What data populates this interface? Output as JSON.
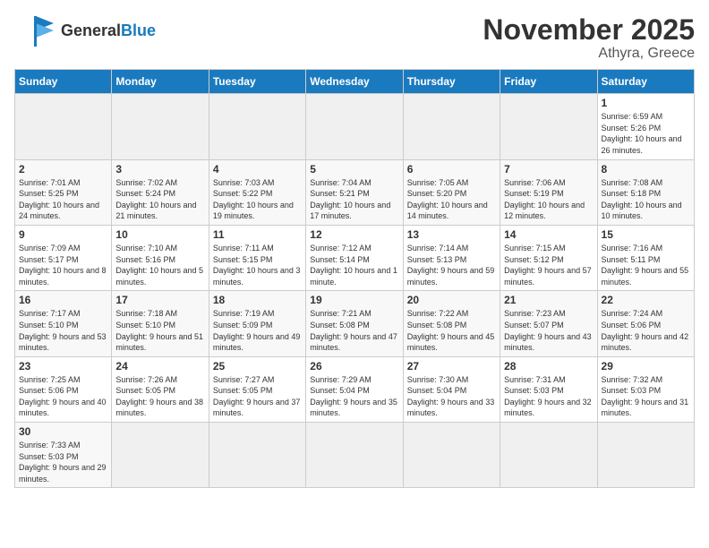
{
  "header": {
    "logo_general": "General",
    "logo_blue": "Blue",
    "title": "November 2025",
    "subtitle": "Athyra, Greece"
  },
  "days_of_week": [
    "Sunday",
    "Monday",
    "Tuesday",
    "Wednesday",
    "Thursday",
    "Friday",
    "Saturday"
  ],
  "weeks": [
    [
      {
        "day": "",
        "empty": true
      },
      {
        "day": "",
        "empty": true
      },
      {
        "day": "",
        "empty": true
      },
      {
        "day": "",
        "empty": true
      },
      {
        "day": "",
        "empty": true
      },
      {
        "day": "",
        "empty": true
      },
      {
        "day": "1",
        "sunrise": "6:59 AM",
        "sunset": "5:26 PM",
        "daylight": "10 hours and 26 minutes."
      }
    ],
    [
      {
        "day": "2",
        "sunrise": "7:01 AM",
        "sunset": "5:25 PM",
        "daylight": "10 hours and 24 minutes."
      },
      {
        "day": "3",
        "sunrise": "7:02 AM",
        "sunset": "5:24 PM",
        "daylight": "10 hours and 21 minutes."
      },
      {
        "day": "4",
        "sunrise": "7:03 AM",
        "sunset": "5:22 PM",
        "daylight": "10 hours and 19 minutes."
      },
      {
        "day": "5",
        "sunrise": "7:04 AM",
        "sunset": "5:21 PM",
        "daylight": "10 hours and 17 minutes."
      },
      {
        "day": "6",
        "sunrise": "7:05 AM",
        "sunset": "5:20 PM",
        "daylight": "10 hours and 14 minutes."
      },
      {
        "day": "7",
        "sunrise": "7:06 AM",
        "sunset": "5:19 PM",
        "daylight": "10 hours and 12 minutes."
      },
      {
        "day": "8",
        "sunrise": "7:08 AM",
        "sunset": "5:18 PM",
        "daylight": "10 hours and 10 minutes."
      }
    ],
    [
      {
        "day": "9",
        "sunrise": "7:09 AM",
        "sunset": "5:17 PM",
        "daylight": "10 hours and 8 minutes."
      },
      {
        "day": "10",
        "sunrise": "7:10 AM",
        "sunset": "5:16 PM",
        "daylight": "10 hours and 5 minutes."
      },
      {
        "day": "11",
        "sunrise": "7:11 AM",
        "sunset": "5:15 PM",
        "daylight": "10 hours and 3 minutes."
      },
      {
        "day": "12",
        "sunrise": "7:12 AM",
        "sunset": "5:14 PM",
        "daylight": "10 hours and 1 minute."
      },
      {
        "day": "13",
        "sunrise": "7:14 AM",
        "sunset": "5:13 PM",
        "daylight": "9 hours and 59 minutes."
      },
      {
        "day": "14",
        "sunrise": "7:15 AM",
        "sunset": "5:12 PM",
        "daylight": "9 hours and 57 minutes."
      },
      {
        "day": "15",
        "sunrise": "7:16 AM",
        "sunset": "5:11 PM",
        "daylight": "9 hours and 55 minutes."
      }
    ],
    [
      {
        "day": "16",
        "sunrise": "7:17 AM",
        "sunset": "5:10 PM",
        "daylight": "9 hours and 53 minutes."
      },
      {
        "day": "17",
        "sunrise": "7:18 AM",
        "sunset": "5:10 PM",
        "daylight": "9 hours and 51 minutes."
      },
      {
        "day": "18",
        "sunrise": "7:19 AM",
        "sunset": "5:09 PM",
        "daylight": "9 hours and 49 minutes."
      },
      {
        "day": "19",
        "sunrise": "7:21 AM",
        "sunset": "5:08 PM",
        "daylight": "9 hours and 47 minutes."
      },
      {
        "day": "20",
        "sunrise": "7:22 AM",
        "sunset": "5:08 PM",
        "daylight": "9 hours and 45 minutes."
      },
      {
        "day": "21",
        "sunrise": "7:23 AM",
        "sunset": "5:07 PM",
        "daylight": "9 hours and 43 minutes."
      },
      {
        "day": "22",
        "sunrise": "7:24 AM",
        "sunset": "5:06 PM",
        "daylight": "9 hours and 42 minutes."
      }
    ],
    [
      {
        "day": "23",
        "sunrise": "7:25 AM",
        "sunset": "5:06 PM",
        "daylight": "9 hours and 40 minutes."
      },
      {
        "day": "24",
        "sunrise": "7:26 AM",
        "sunset": "5:05 PM",
        "daylight": "9 hours and 38 minutes."
      },
      {
        "day": "25",
        "sunrise": "7:27 AM",
        "sunset": "5:05 PM",
        "daylight": "9 hours and 37 minutes."
      },
      {
        "day": "26",
        "sunrise": "7:29 AM",
        "sunset": "5:04 PM",
        "daylight": "9 hours and 35 minutes."
      },
      {
        "day": "27",
        "sunrise": "7:30 AM",
        "sunset": "5:04 PM",
        "daylight": "9 hours and 33 minutes."
      },
      {
        "day": "28",
        "sunrise": "7:31 AM",
        "sunset": "5:03 PM",
        "daylight": "9 hours and 32 minutes."
      },
      {
        "day": "29",
        "sunrise": "7:32 AM",
        "sunset": "5:03 PM",
        "daylight": "9 hours and 31 minutes."
      }
    ],
    [
      {
        "day": "30",
        "sunrise": "7:33 AM",
        "sunset": "5:03 PM",
        "daylight": "9 hours and 29 minutes."
      },
      {
        "day": "",
        "empty": true
      },
      {
        "day": "",
        "empty": true
      },
      {
        "day": "",
        "empty": true
      },
      {
        "day": "",
        "empty": true
      },
      {
        "day": "",
        "empty": true
      },
      {
        "day": "",
        "empty": true
      }
    ]
  ]
}
